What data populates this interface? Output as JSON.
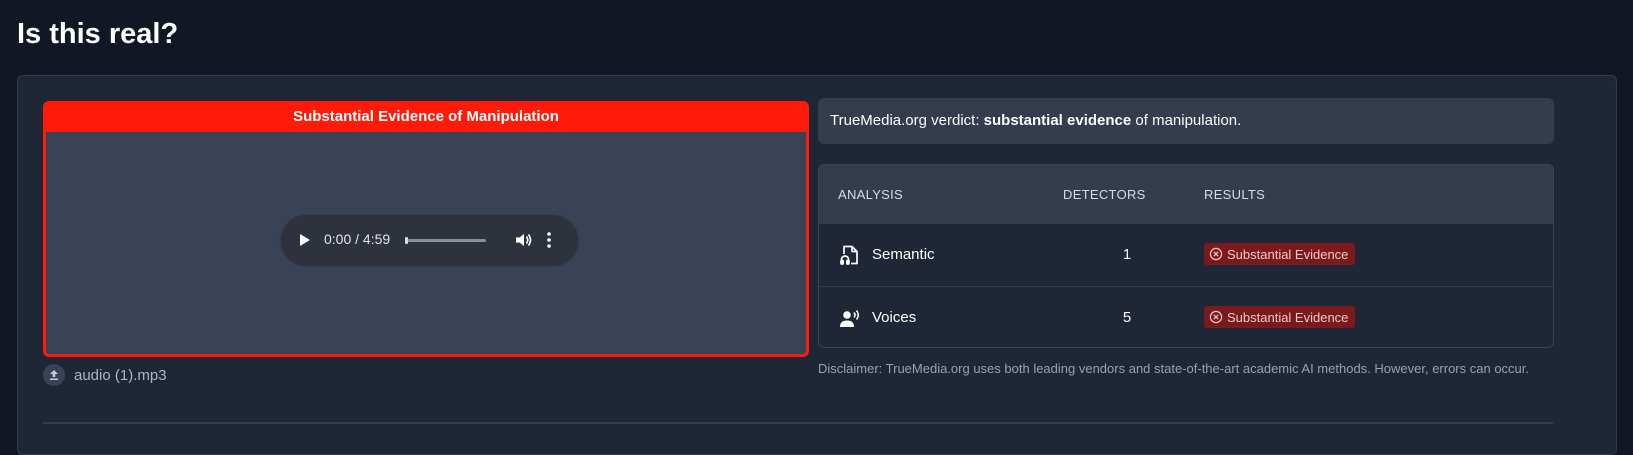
{
  "page": {
    "title": "Is this real?"
  },
  "media": {
    "banner": "Substantial Evidence of Manipulation",
    "player": {
      "time": "0:00 / 4:59",
      "progress": 0
    },
    "file_name": "audio (1).mp3"
  },
  "verdict": {
    "prefix": "TrueMedia.org verdict: ",
    "emphasis": "substantial evidence",
    "suffix": " of manipulation."
  },
  "table": {
    "headers": {
      "analysis": "ANALYSIS",
      "detectors": "DETECTORS",
      "results": "RESULTS"
    },
    "rows": [
      {
        "label": "Semantic",
        "icon": "semantic-file-audio-icon",
        "detectors": "1",
        "result": "Substantial Evidence"
      },
      {
        "label": "Voices",
        "icon": "voice-speaker-icon",
        "detectors": "5",
        "result": "Substantial Evidence"
      }
    ]
  },
  "disclaimer": "Disclaimer: TrueMedia.org uses both leading vendors and state-of-the-art academic AI methods. However, errors can occur.",
  "colors": {
    "background": "#121726",
    "panel": "#1f2636",
    "alert_red": "#ff1a0a",
    "badge_bg": "#7a1a1c",
    "badge_text": "#f3c7c7"
  }
}
